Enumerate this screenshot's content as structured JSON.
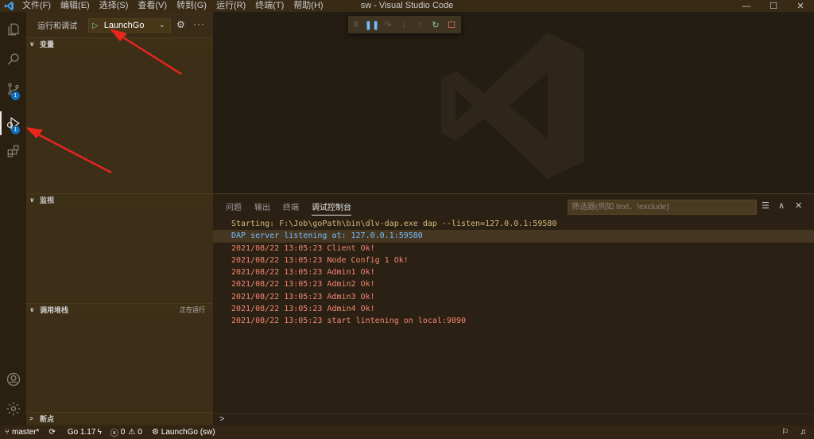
{
  "titlebar": {
    "menu": [
      "文件(F)",
      "编辑(E)",
      "选择(S)",
      "查看(V)",
      "转到(G)",
      "运行(R)",
      "终端(T)",
      "帮助(H)"
    ],
    "title": "sw - Visual Studio Code"
  },
  "activitybar": {
    "source_control_badge": "1",
    "run_debug_badge": "1"
  },
  "sidebar": {
    "view_title": "运行和调试",
    "launch_config": "LaunchGo",
    "sections": {
      "variables": "变量",
      "watch": "监视",
      "call_stack": "调用堆栈",
      "call_stack_status": "正在运行",
      "breakpoints": "断点"
    }
  },
  "panel": {
    "tabs": [
      "问题",
      "输出",
      "终端",
      "调试控制台"
    ],
    "active_tab": "调试控制台",
    "filter_placeholder": "筛选器(例如 text、!exclude)",
    "console_lines": [
      {
        "text": "Starting: F:\\Job\\goPath\\bin\\dlv-dap.exe dap --listen=127.0.0.1:59580",
        "color": "#d7ba7d"
      },
      {
        "text": "DAP server listening at: 127.0.0.1:59580",
        "color": "#75beff"
      },
      {
        "text": "2021/08/22 13:05:23 Client Ok!",
        "color": "#f48771"
      },
      {
        "text": "2021/08/22 13:05:23 Node Config 1 Ok!",
        "color": "#f48771"
      },
      {
        "text": "2021/08/22 13:05:23 Admin1 Ok!",
        "color": "#f48771"
      },
      {
        "text": "2021/08/22 13:05:23 Admin2 Ok!",
        "color": "#f48771"
      },
      {
        "text": "2021/08/22 13:05:23 Admin3 Ok!",
        "color": "#f48771"
      },
      {
        "text": "2021/08/22 13:05:23 Admin4 Ok!",
        "color": "#f48771"
      },
      {
        "text": "2021/08/22 13:05:23 start lintening on local:9090",
        "color": "#f48771"
      }
    ],
    "prompt": ">"
  },
  "statusbar": {
    "branch": "master*",
    "go_version": "Go 1.17",
    "errors": "0",
    "warnings": "0",
    "debug_config": "LaunchGo (sw)"
  },
  "colors": {
    "titlebar": "#382a15",
    "sidebar": "#3a2c16",
    "editor": "#241d13",
    "panel": "#2a2013",
    "statusbar": "#332513",
    "accent_badge": "#0e70c0",
    "annotation_arrow": "#e8261c"
  }
}
